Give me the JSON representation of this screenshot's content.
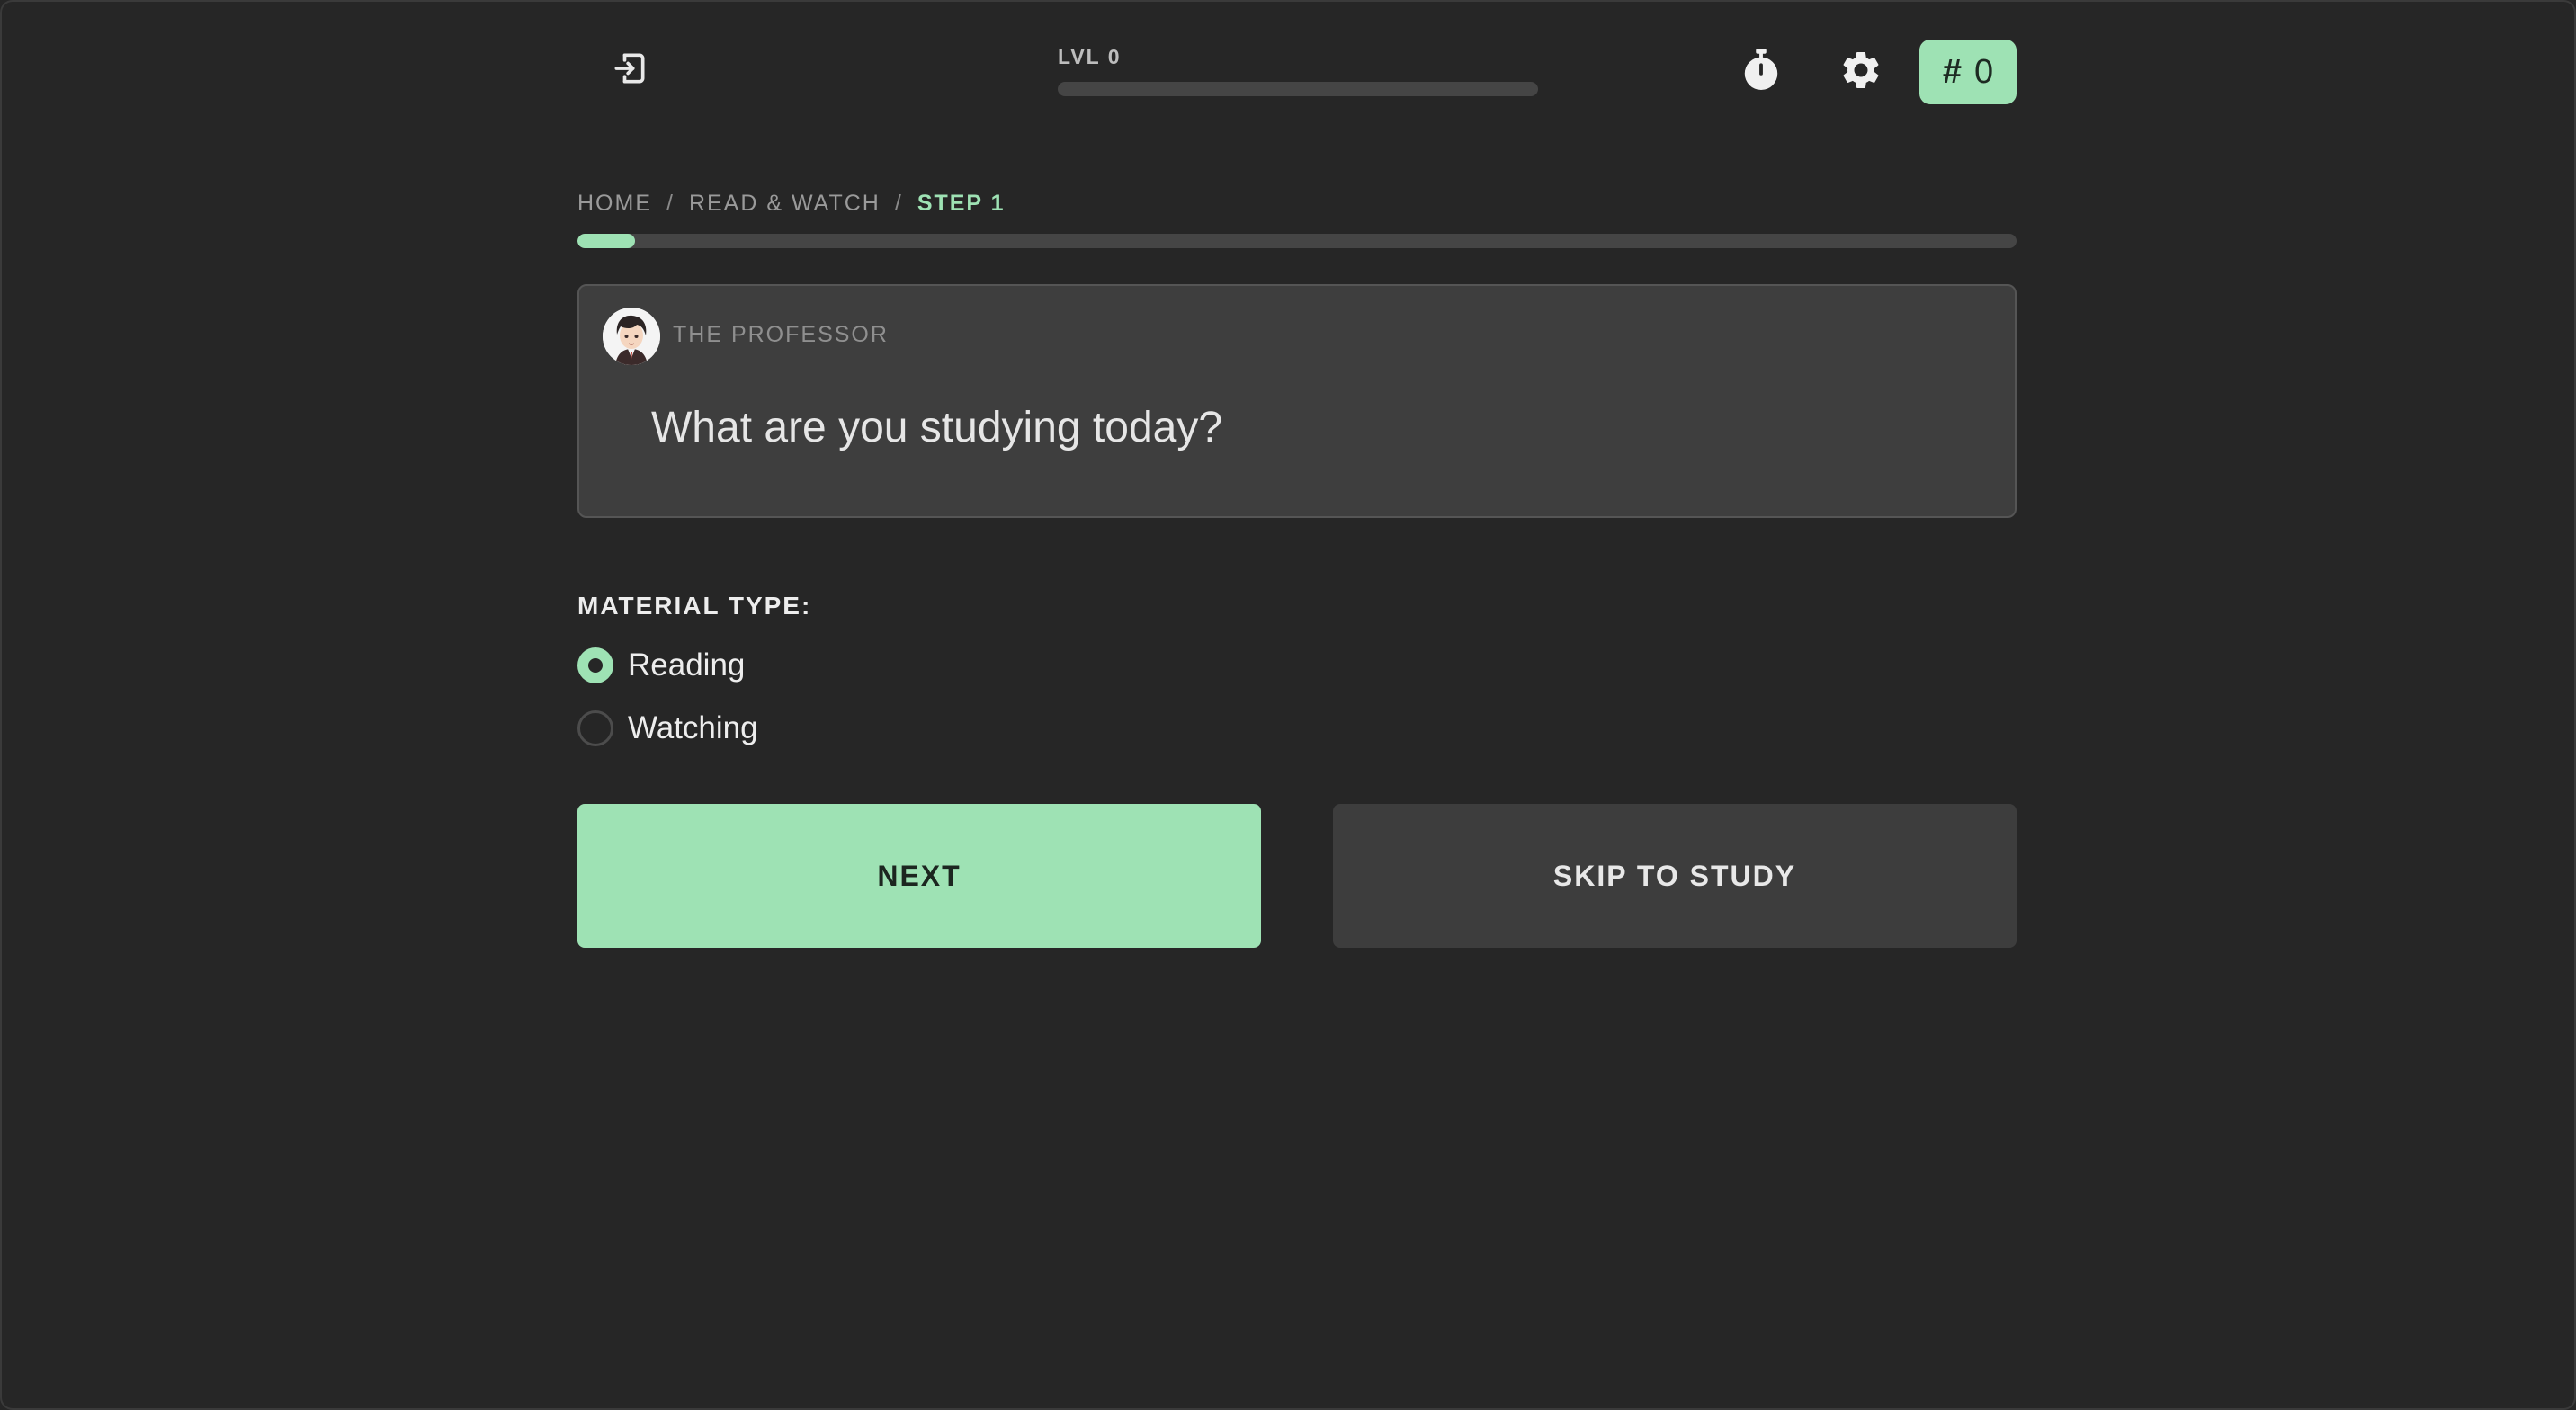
{
  "header": {
    "level_label": "LVL 0",
    "level_progress": 0,
    "count_symbol": "#",
    "count_value": "0"
  },
  "icons": {
    "exit": "exit-icon",
    "timer": "stopwatch-icon",
    "settings": "gear-icon"
  },
  "breadcrumb": {
    "items": [
      "HOME",
      "READ & WATCH",
      "STEP 1"
    ],
    "separator": "/"
  },
  "step_progress": 0.04,
  "card": {
    "speaker": "THE PROFESSOR",
    "message": "What are you studying today?"
  },
  "material": {
    "label": "MATERIAL TYPE:",
    "options": [
      {
        "label": "Reading",
        "selected": true
      },
      {
        "label": "Watching",
        "selected": false
      }
    ]
  },
  "buttons": {
    "next": "NEXT",
    "skip": "SKIP TO STUDY"
  },
  "colors": {
    "background": "#262626",
    "accent": "#9ee2b4",
    "card": "#3e3e3e",
    "track": "#454545"
  }
}
